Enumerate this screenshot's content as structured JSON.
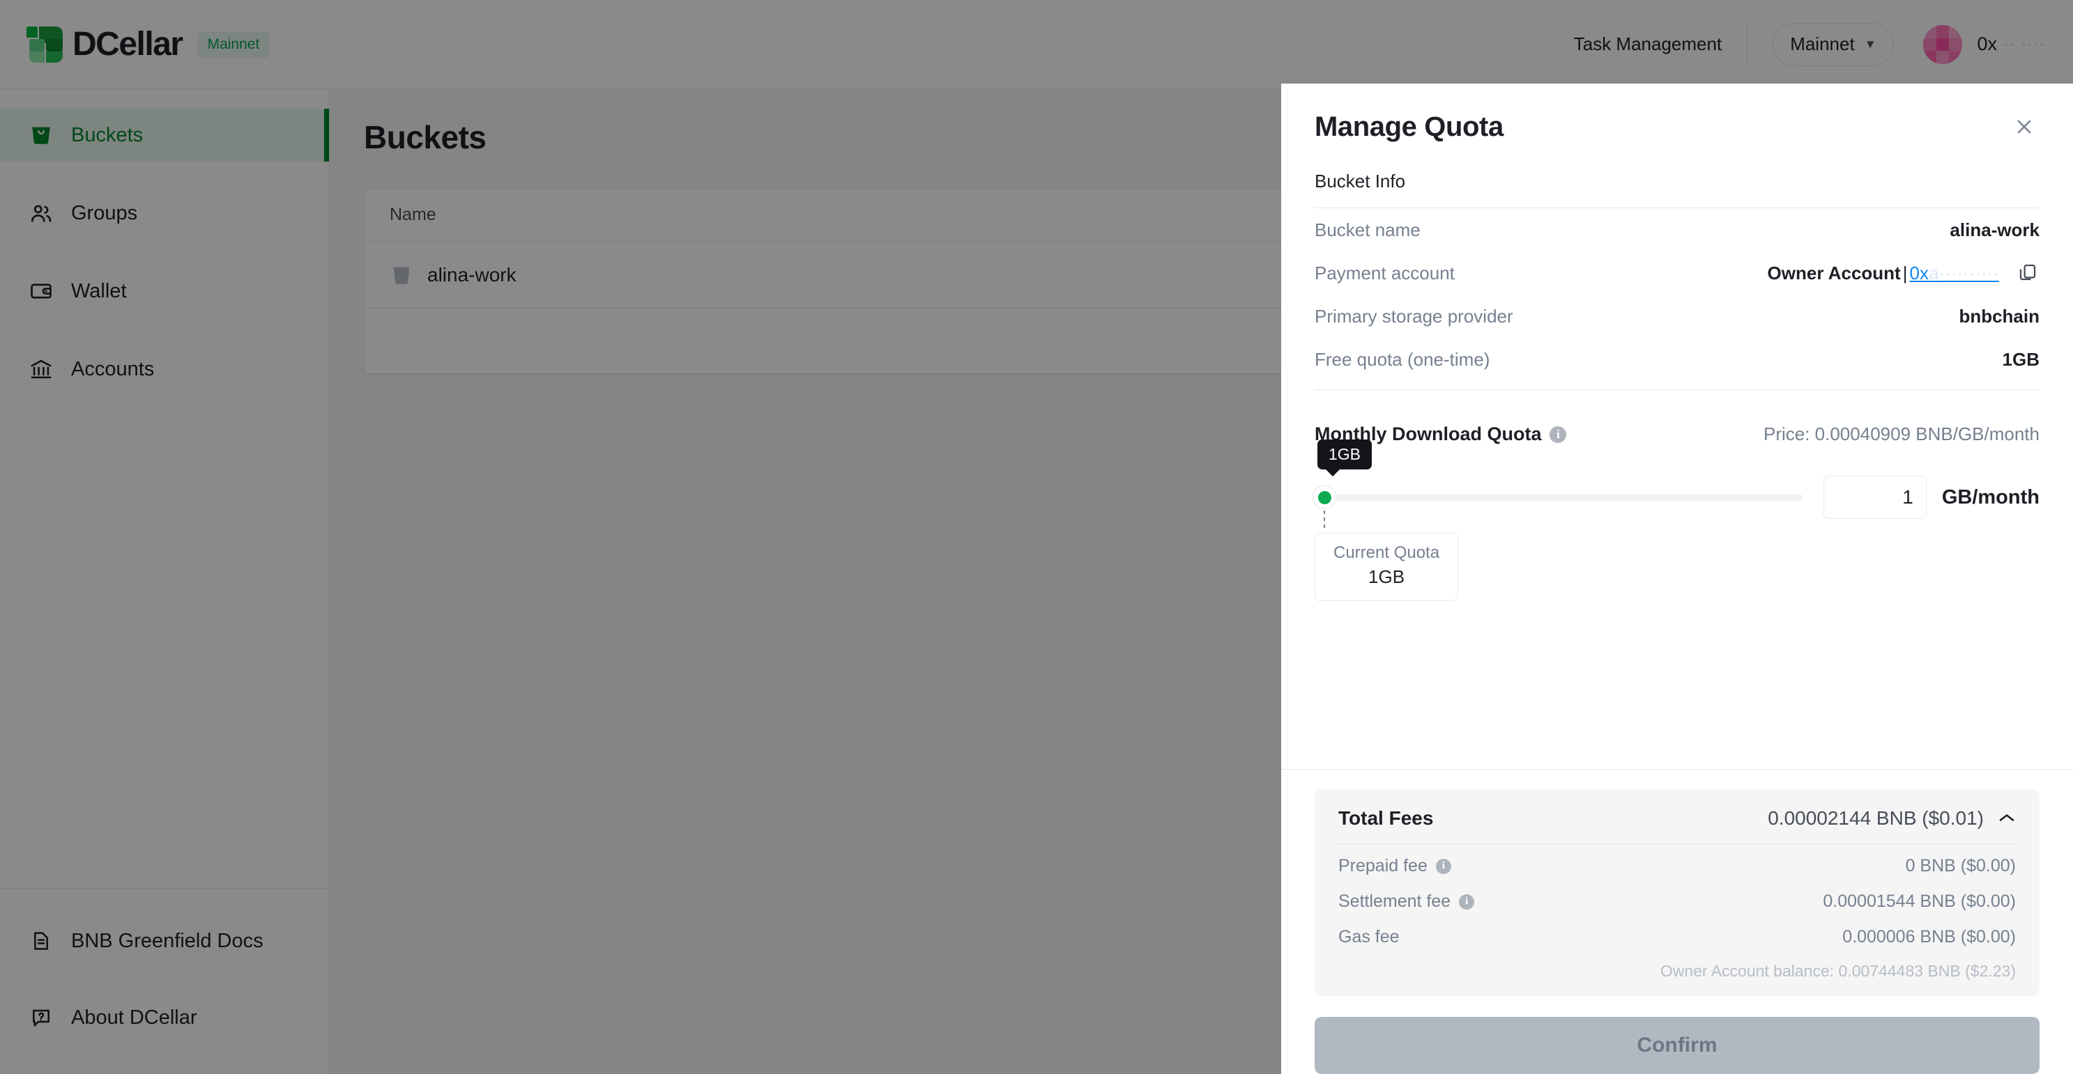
{
  "header": {
    "brand_name": "DCellar",
    "network_badge": "Mainnet",
    "task_management": "Task Management",
    "network_select": "Mainnet",
    "account_address_prefix": "0x",
    "account_address_masked": "   ··   ····"
  },
  "sidebar": {
    "items": [
      {
        "label": "Buckets",
        "icon": "bucket-icon",
        "active": true
      },
      {
        "label": "Groups",
        "icon": "groups-icon",
        "active": false
      },
      {
        "label": "Wallet",
        "icon": "wallet-icon",
        "active": false
      },
      {
        "label": "Accounts",
        "icon": "bank-icon",
        "active": false
      }
    ],
    "bottom_items": [
      {
        "label": "BNB Greenfield Docs",
        "icon": "document-icon"
      },
      {
        "label": "About DCellar",
        "icon": "question-chat-icon"
      }
    ]
  },
  "main": {
    "page_title": "Buckets",
    "table": {
      "columns": [
        "Name"
      ],
      "rows": [
        {
          "name": "alina-work"
        }
      ]
    }
  },
  "drawer": {
    "title": "Manage Quota",
    "close_label": "✕",
    "bucket_info": {
      "section_label": "Bucket Info",
      "rows": [
        {
          "key": "Bucket name",
          "value": "alina-work"
        },
        {
          "key": "Primary storage provider",
          "value": "bnbchain"
        },
        {
          "key": "Free quota (one-time)",
          "value": "1GB"
        }
      ],
      "payment_account": {
        "key": "Payment account",
        "owner_label": "Owner Account",
        "separator": "|",
        "link_prefix": "0x",
        "link_masked": "a··········"
      }
    },
    "quota": {
      "title": "Monthly Download Quota",
      "price_note": "Price: 0.00040909 BNB/GB/month",
      "slider_tooltip": "1GB",
      "slider_value_percent": 0,
      "current_quota_label": "Current Quota",
      "current_quota_value": "1GB",
      "input_value": "1",
      "unit_label": "GB/month"
    },
    "fees": {
      "title": "Total Fees",
      "total": "0.00002144 BNB ($0.01)",
      "chevron": "⌃",
      "rows": [
        {
          "label": "Prepaid fee",
          "has_info": true,
          "value": "0 BNB ($0.00)"
        },
        {
          "label": "Settlement fee",
          "has_info": true,
          "value": "0.00001544 BNB ($0.00)"
        },
        {
          "label": "Gas fee",
          "has_info": false,
          "value": "0.000006 BNB ($0.00)"
        }
      ],
      "balance_note": "Owner Account balance: 0.00744483 BNB ($2.23)"
    },
    "confirm_label": "Confirm"
  },
  "colors": {
    "accent_green": "#00862d",
    "badge_green": "#07a358",
    "link_blue": "#1184ee",
    "slider_green": "#0bab4e",
    "muted": "#76808f"
  }
}
